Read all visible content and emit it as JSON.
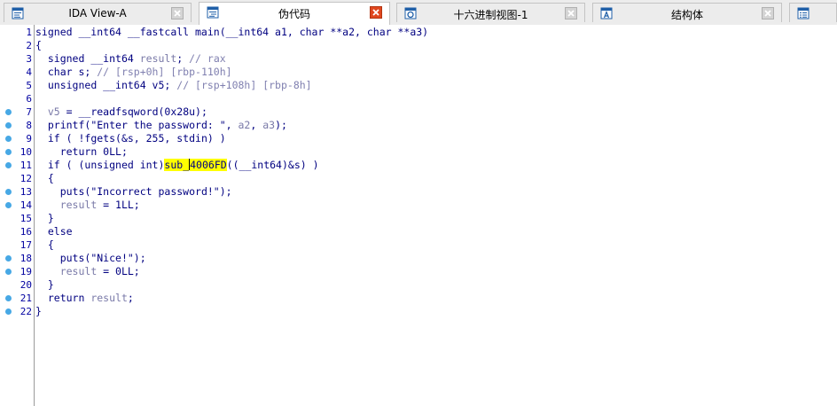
{
  "tabs": [
    {
      "label": "IDA View-A",
      "icon": "disassembly-view-icon",
      "active": false
    },
    {
      "label": "伪代码",
      "icon": "pseudocode-icon",
      "active": true
    },
    {
      "label": "十六进制视图-1",
      "icon": "hex-view-icon",
      "active": false
    },
    {
      "label": "结构体",
      "icon": "structures-icon",
      "active": false
    },
    {
      "label": "",
      "icon": "enums-icon",
      "active": false
    }
  ],
  "colors": {
    "keyword": "#000080",
    "comment": "#8080b0",
    "variable": "#7a7aa8",
    "highlight": "#ffff00",
    "breakpoint_dot": "#47a8e5",
    "close_icon": "#e0471f"
  },
  "code": [
    {
      "n": "1",
      "dot": false,
      "indent": "",
      "parts": [
        {
          "t": "k",
          "s": "signed __int64 __fastcall main(__int64 a1, char **a2, char **a3)"
        }
      ]
    },
    {
      "n": "2",
      "dot": false,
      "indent": "",
      "parts": [
        {
          "t": "k",
          "s": "{"
        }
      ]
    },
    {
      "n": "3",
      "dot": false,
      "indent": "  ",
      "parts": [
        {
          "t": "k",
          "s": "signed __int64 "
        },
        {
          "t": "v",
          "s": "result"
        },
        {
          "t": "k",
          "s": "; "
        },
        {
          "t": "c",
          "s": "// rax"
        }
      ]
    },
    {
      "n": "4",
      "dot": false,
      "indent": "  ",
      "parts": [
        {
          "t": "k",
          "s": "char s; "
        },
        {
          "t": "c",
          "s": "// [rsp+0h] [rbp-110h]"
        }
      ]
    },
    {
      "n": "5",
      "dot": false,
      "indent": "  ",
      "parts": [
        {
          "t": "k",
          "s": "unsigned __int64 v5; "
        },
        {
          "t": "c",
          "s": "// [rsp+108h] [rbp-8h]"
        }
      ]
    },
    {
      "n": "6",
      "dot": false,
      "indent": "",
      "parts": []
    },
    {
      "n": "7",
      "dot": true,
      "indent": "  ",
      "parts": [
        {
          "t": "v",
          "s": "v5"
        },
        {
          "t": "k",
          "s": " = __readfsqword(0x28u);"
        }
      ]
    },
    {
      "n": "8",
      "dot": true,
      "indent": "  ",
      "parts": [
        {
          "t": "k",
          "s": "printf(\"Enter the password: \", "
        },
        {
          "t": "v",
          "s": "a2"
        },
        {
          "t": "k",
          "s": ", "
        },
        {
          "t": "v",
          "s": "a3"
        },
        {
          "t": "k",
          "s": ");"
        }
      ]
    },
    {
      "n": "9",
      "dot": true,
      "indent": "  ",
      "parts": [
        {
          "t": "k",
          "s": "if ( !fgets(&s, 255, stdin) )"
        }
      ]
    },
    {
      "n": "10",
      "dot": true,
      "indent": "    ",
      "parts": [
        {
          "t": "k",
          "s": "return 0LL;"
        }
      ]
    },
    {
      "n": "11",
      "dot": true,
      "indent": "  ",
      "parts": [
        {
          "t": "k",
          "s": "if ( (unsigned int)"
        },
        {
          "t": "hl",
          "s": "sub_"
        },
        {
          "t": "cursor",
          "s": ""
        },
        {
          "t": "hl",
          "s": "4006FD"
        },
        {
          "t": "k",
          "s": "((__int64)&s) )"
        }
      ]
    },
    {
      "n": "12",
      "dot": false,
      "indent": "  ",
      "parts": [
        {
          "t": "k",
          "s": "{"
        }
      ]
    },
    {
      "n": "13",
      "dot": true,
      "indent": "    ",
      "parts": [
        {
          "t": "k",
          "s": "puts(\"Incorrect password!\");"
        }
      ]
    },
    {
      "n": "14",
      "dot": true,
      "indent": "    ",
      "parts": [
        {
          "t": "v",
          "s": "result"
        },
        {
          "t": "k",
          "s": " = 1LL;"
        }
      ]
    },
    {
      "n": "15",
      "dot": false,
      "indent": "  ",
      "parts": [
        {
          "t": "k",
          "s": "}"
        }
      ]
    },
    {
      "n": "16",
      "dot": false,
      "indent": "  ",
      "parts": [
        {
          "t": "k",
          "s": "else"
        }
      ]
    },
    {
      "n": "17",
      "dot": false,
      "indent": "  ",
      "parts": [
        {
          "t": "k",
          "s": "{"
        }
      ]
    },
    {
      "n": "18",
      "dot": true,
      "indent": "    ",
      "parts": [
        {
          "t": "k",
          "s": "puts(\"Nice!\");"
        }
      ]
    },
    {
      "n": "19",
      "dot": true,
      "indent": "    ",
      "parts": [
        {
          "t": "v",
          "s": "result"
        },
        {
          "t": "k",
          "s": " = 0LL;"
        }
      ]
    },
    {
      "n": "20",
      "dot": false,
      "indent": "  ",
      "parts": [
        {
          "t": "k",
          "s": "}"
        }
      ]
    },
    {
      "n": "21",
      "dot": true,
      "indent": "  ",
      "parts": [
        {
          "t": "k",
          "s": "return "
        },
        {
          "t": "v",
          "s": "result"
        },
        {
          "t": "k",
          "s": ";"
        }
      ]
    },
    {
      "n": "22",
      "dot": true,
      "indent": "",
      "parts": [
        {
          "t": "k",
          "s": "}"
        }
      ]
    }
  ]
}
